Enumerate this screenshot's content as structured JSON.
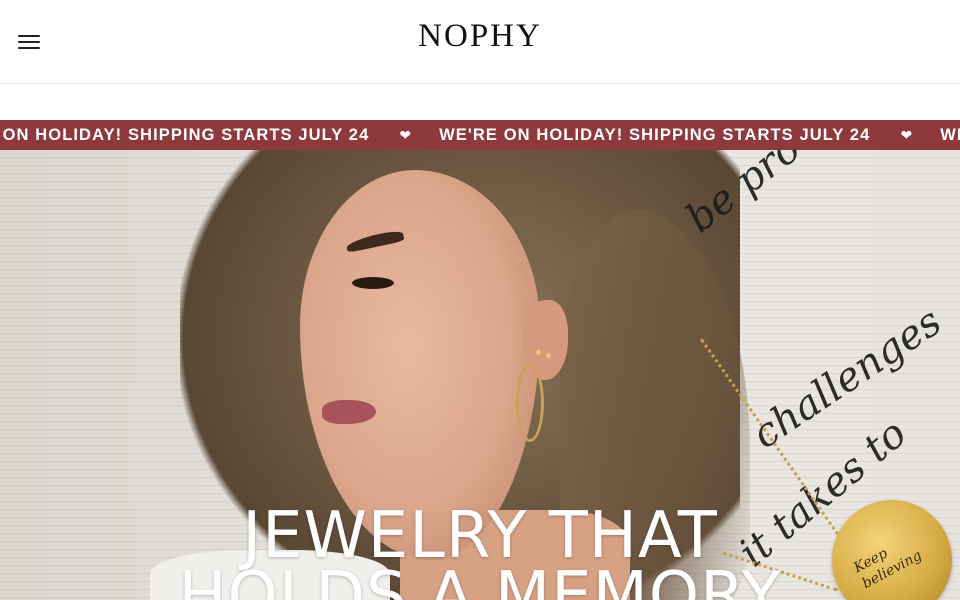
{
  "header": {
    "logo_text": "NOPHY",
    "menu_icon": "hamburger-menu-icon"
  },
  "announcement": {
    "message": "WE'RE ON HOLIDAY! SHIPPING STARTS JULY 24",
    "separator_icon": "heart-icon",
    "background_color": "#8e3a3c",
    "text_color": "#ffffff"
  },
  "hero": {
    "headline_line1": "JEWELRY THAT",
    "headline_line2": "HOLDS A MEMORY",
    "script_line1": "be prouder of",
    "script_line2": "challenges",
    "script_line3": "it takes to",
    "pendant_text": "Keep believing"
  }
}
